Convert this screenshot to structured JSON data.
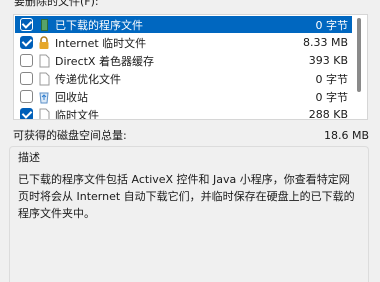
{
  "header": {
    "label": "要删除的文件(F):"
  },
  "file_list": {
    "items": [
      {
        "label": "已下载的程序文件",
        "size": "0 字节",
        "checked": true,
        "selected": true,
        "icon": "folder-icon"
      },
      {
        "label": "Internet 临时文件",
        "size": "8.33 MB",
        "checked": true,
        "selected": false,
        "icon": "lock-icon"
      },
      {
        "label": "DirectX 着色器缓存",
        "size": "393 KB",
        "checked": false,
        "selected": false,
        "icon": "file-icon"
      },
      {
        "label": "传递优化文件",
        "size": "0 字节",
        "checked": false,
        "selected": false,
        "icon": "file-icon"
      },
      {
        "label": "回收站",
        "size": "0 字节",
        "checked": false,
        "selected": false,
        "icon": "recycle-bin-icon"
      },
      {
        "label": "临时文件",
        "size": "288 KB",
        "checked": true,
        "selected": false,
        "icon": "file-icon"
      }
    ]
  },
  "space": {
    "label": "可获得的磁盘空间总量:",
    "value": "18.6 MB"
  },
  "description": {
    "title": "描述",
    "text": "已下载的程序文件包括 ActiveX 控件和 Java 小程序，你查看特定网页时将会从 Internet 自动下载它们，并临时保存在硬盘上的已下载的程序文件夹中。"
  },
  "colors": {
    "selection": "#0067c0",
    "checkbox": "#005fb8",
    "background": "#f0f0f0"
  }
}
